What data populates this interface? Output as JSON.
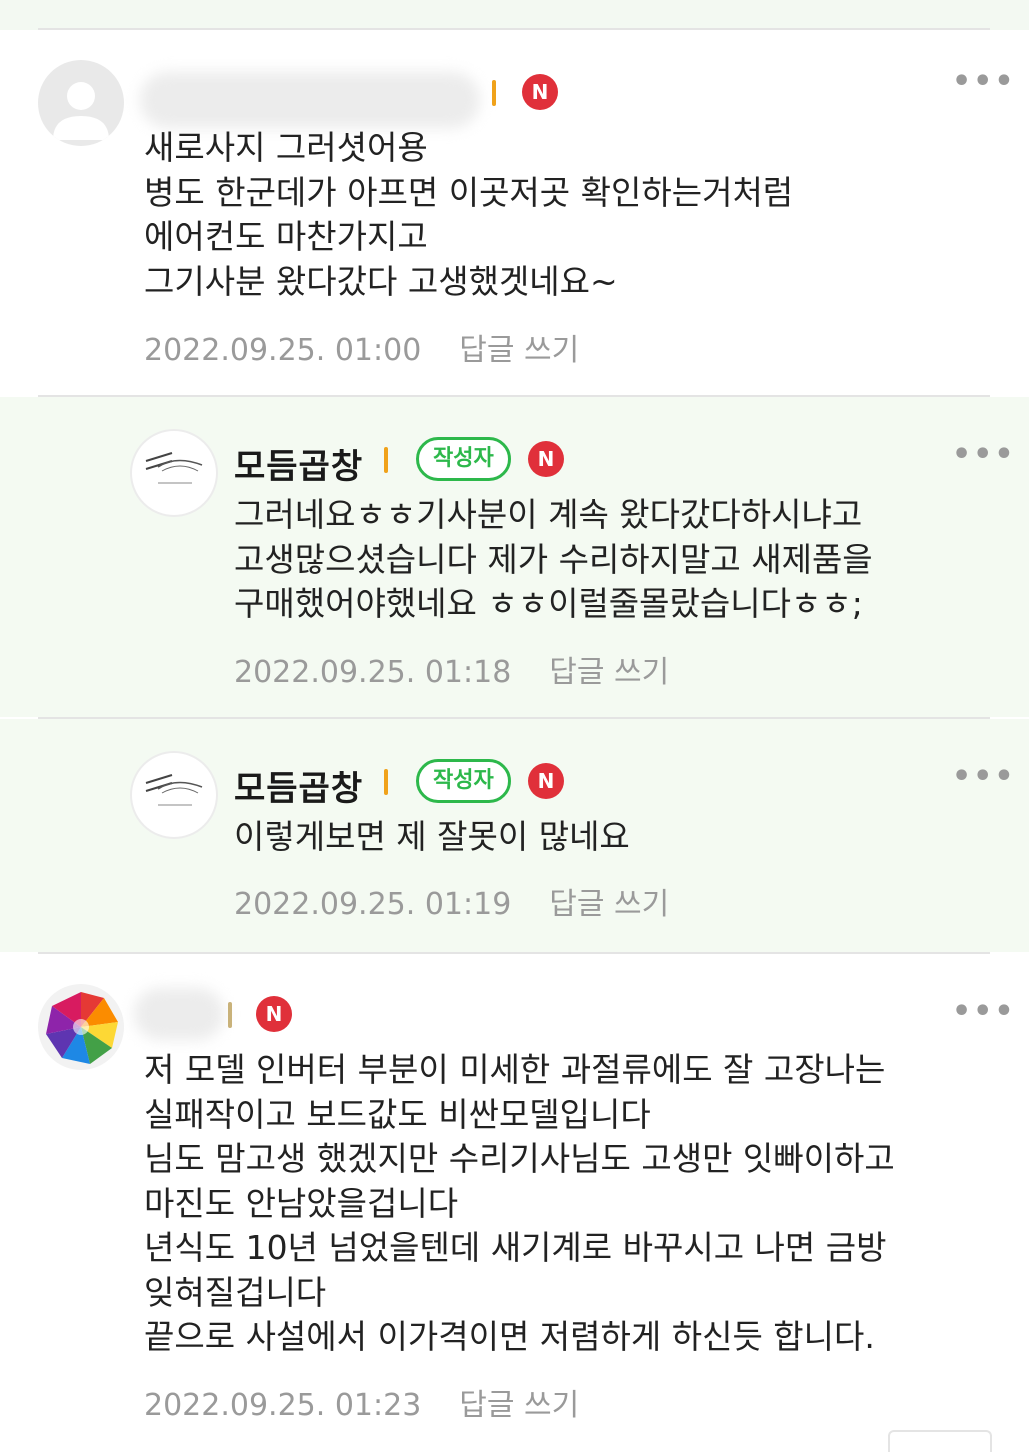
{
  "comments": [
    {
      "nickname": "",
      "badge": "N",
      "text": "새로사지 그러셧어용\n병도 한군데가 아프면 이곳저곳 확인하는거처럼\n에어컨도 마찬가지고\n그기사분 왔다갔다 고생했겟네요~",
      "date": "2022.09.25. 01:00",
      "reply_label": "답글 쓰기",
      "avatar": "default-profile-icon"
    },
    {
      "nickname": "모듬곱창",
      "author_badge": "작성자",
      "badge": "N",
      "text": "그러네요ㅎㅎ기사분이 계속 왔다갔다하시냐고\n고생많으셨습니다 제가 수리하지말고 새제품을\n구매했어야했네요 ㅎㅎ이럴줄몰랐습니다ㅎㅎ;",
      "date": "2022.09.25. 01:18",
      "reply_label": "답글 쓰기",
      "avatar": "shop-logo-icon"
    },
    {
      "nickname": "모듬곱창",
      "author_badge": "작성자",
      "badge": "N",
      "text": "이렇게보면 제 잘못이 많네요",
      "date": "2022.09.25. 01:19",
      "reply_label": "답글 쓰기",
      "avatar": "shop-logo-icon"
    },
    {
      "nickname": "",
      "badge": "N",
      "text": "저 모델 인버터 부분이 미세한 과절류에도 잘 고장나는\n실패작이고 보드값도 비싼모델입니다\n님도 맘고생 했겠지만 수리기사님도 고생만 잇빠이하고\n마진도 안남았을겁니다\n년식도 10년 넘었을텐데 새기계로 바꾸시고 나면 금방\n잊혀질겁니다\n끝으로 사설에서 이가격이면 저렴하게 하신듯 합니다.",
      "date": "2022.09.25. 01:23",
      "reply_label": "답글 쓰기",
      "avatar": "colorful-map-icon"
    }
  ],
  "more_icon": "more-dots-icon",
  "colors": {
    "badge_red": "#e0303a",
    "author_green": "#2db84b",
    "reply_bg": "#f4faf2",
    "meta_gray": "#9a9a9a"
  }
}
